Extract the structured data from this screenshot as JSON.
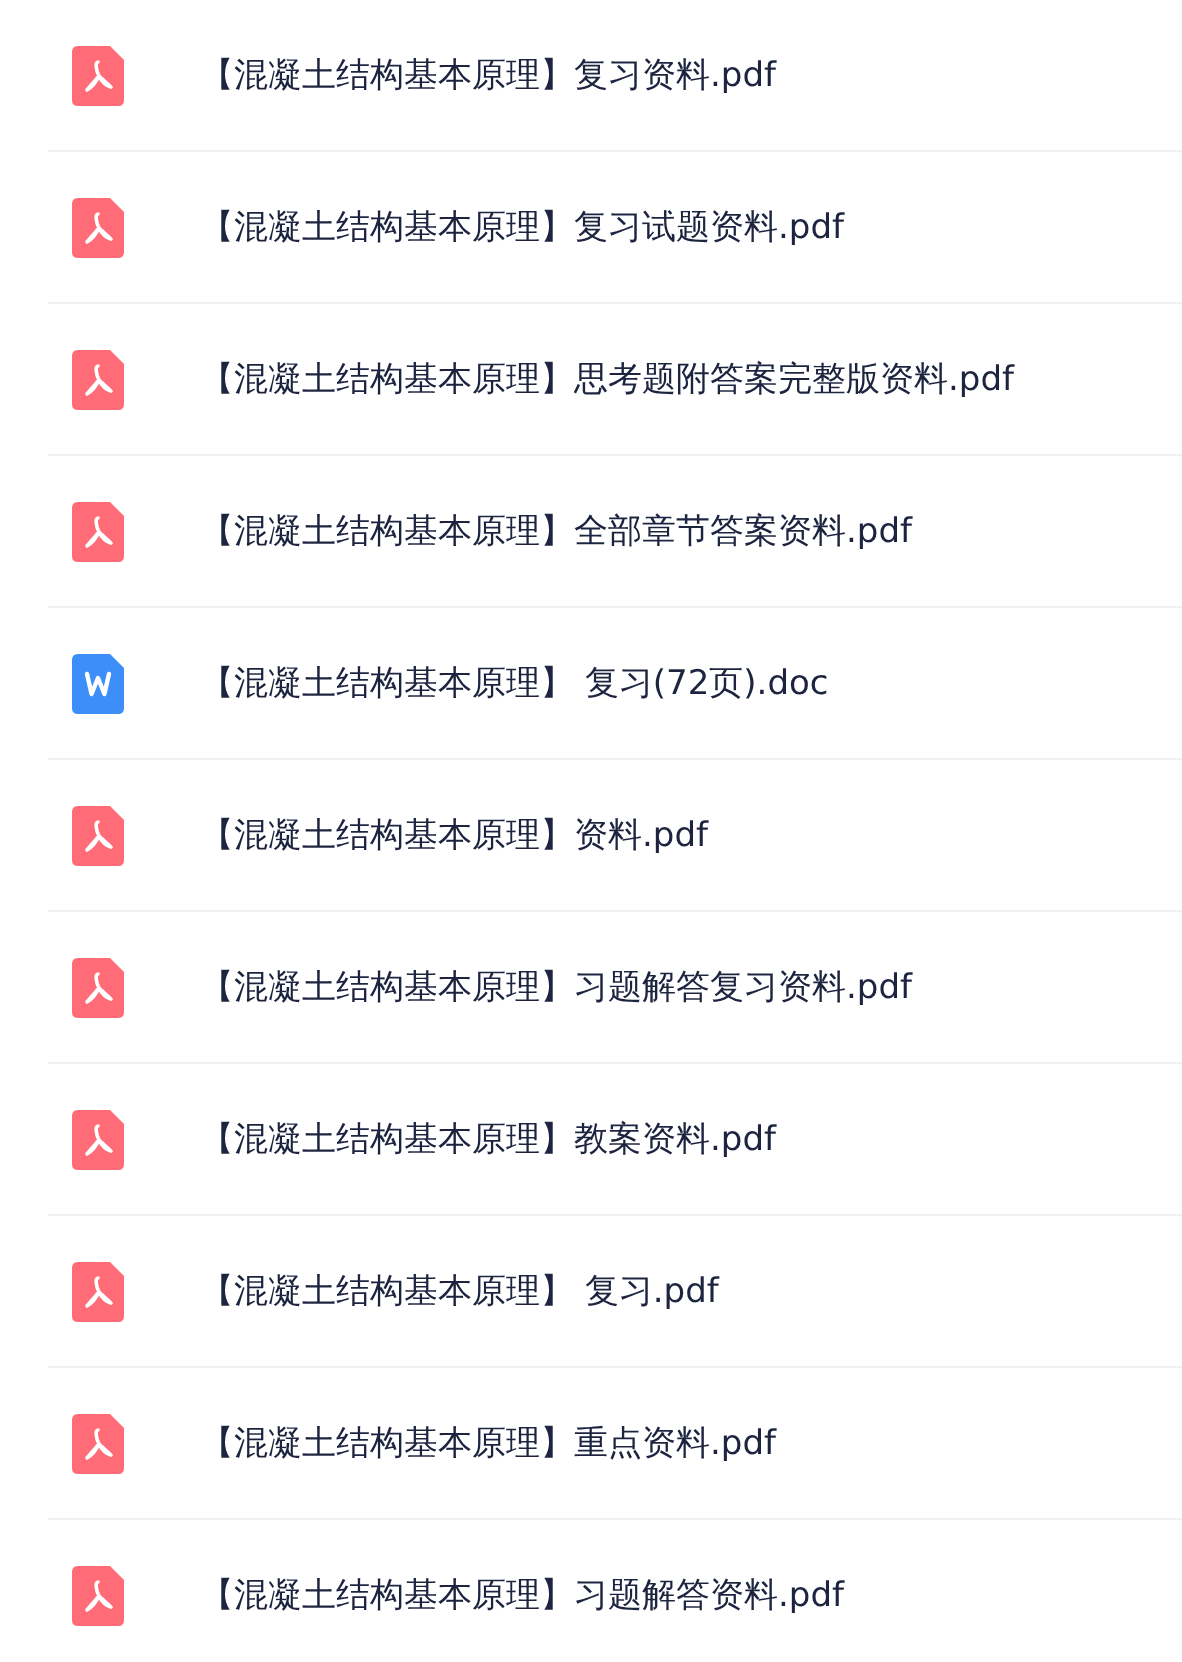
{
  "files": [
    {
      "kind": "pdf",
      "name": "【混凝土结构基本原理】复习资料.pdf"
    },
    {
      "kind": "pdf",
      "name": "【混凝土结构基本原理】复习试题资料.pdf"
    },
    {
      "kind": "pdf",
      "name": "【混凝土结构基本原理】思考题附答案完整版资料.pdf"
    },
    {
      "kind": "pdf",
      "name": "【混凝土结构基本原理】全部章节答案资料.pdf"
    },
    {
      "kind": "doc",
      "name": "【混凝土结构基本原理】 复习(72页).doc"
    },
    {
      "kind": "pdf",
      "name": "【混凝土结构基本原理】资料.pdf"
    },
    {
      "kind": "pdf",
      "name": "【混凝土结构基本原理】习题解答复习资料.pdf"
    },
    {
      "kind": "pdf",
      "name": "【混凝土结构基本原理】教案资料.pdf"
    },
    {
      "kind": "pdf",
      "name": "【混凝土结构基本原理】 复习.pdf"
    },
    {
      "kind": "pdf",
      "name": "【混凝土结构基本原理】重点资料.pdf"
    },
    {
      "kind": "pdf",
      "name": "【混凝土结构基本原理】习题解答资料.pdf"
    }
  ]
}
